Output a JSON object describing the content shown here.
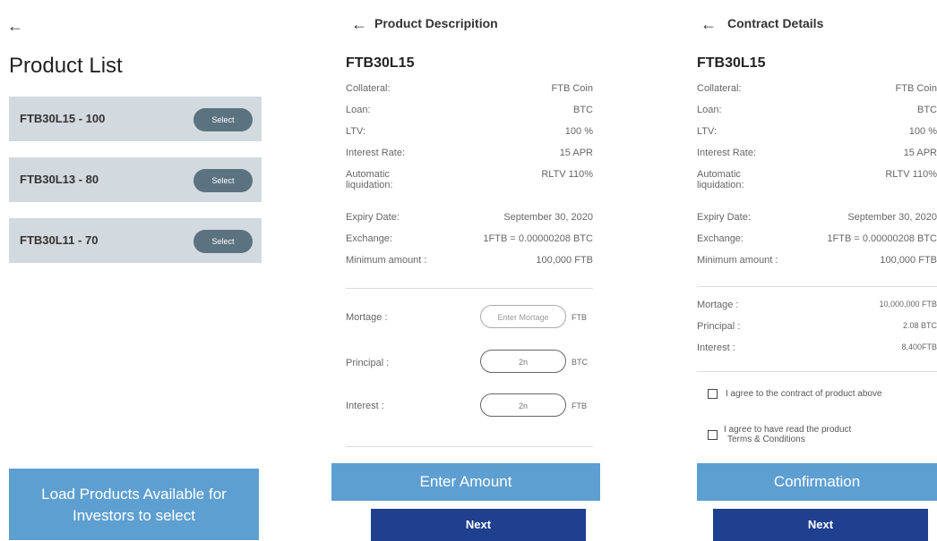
{
  "screen1": {
    "back_icon": "←",
    "title": "Product List",
    "products": [
      {
        "label": "FTB30L15 - 100",
        "button": "Select"
      },
      {
        "label": "FTB30L13 - 80",
        "button": "Select"
      },
      {
        "label": "FTB30L11 - 70",
        "button": "Select"
      }
    ],
    "load_box": "Load Products Available for Investors to select"
  },
  "screen2": {
    "back_icon": "←",
    "header": "Product Descripition",
    "code": "FTB30L15",
    "details": [
      {
        "label": "Collateral:",
        "value": "FTB Coin"
      },
      {
        "label": "Loan:",
        "value": "BTC"
      },
      {
        "label": "LTV:",
        "value": "100 %"
      },
      {
        "label": "Interest Rate:",
        "value": "15  APR"
      },
      {
        "label": "Automatic liquidation:",
        "value": "RLTV 110%"
      },
      {
        "label": "Expiry Date:",
        "value": "September 30, 2020"
      },
      {
        "label": "Exchange:",
        "value": "1FTB = 0.00000208 BTC"
      },
      {
        "label": "Minimum amount :",
        "value": "100,000 FTB"
      }
    ],
    "inputs": [
      {
        "label": "Mortage :",
        "value": "Enter Mortage",
        "unit": "FTB"
      },
      {
        "label": "Principal :",
        "value": "2n",
        "unit": "BTC"
      },
      {
        "label": "Interest :",
        "value": "2n",
        "unit": "FTB"
      }
    ],
    "enter_box": "Enter Amount",
    "next": "Next"
  },
  "screen3": {
    "back_icon": "←",
    "header": "Contract Details",
    "code": "FTB30L15",
    "details": [
      {
        "label": "Collateral:",
        "value": "FTB Coin"
      },
      {
        "label": "Loan:",
        "value": "BTC"
      },
      {
        "label": "LTV:",
        "value": "100 %"
      },
      {
        "label": "Interest Rate:",
        "value": "15  APR"
      },
      {
        "label": "Automatic liquidation:",
        "value": "RLTV 110%"
      },
      {
        "label": "Expiry Date:",
        "value": "September 30, 2020"
      },
      {
        "label": "Exchange:",
        "value": "1FTB = 0.00000208 BTC"
      },
      {
        "label": "Minimum amount :",
        "value": "100,000 FTB"
      }
    ],
    "summary": [
      {
        "label": "Mortage :",
        "value": "10,000,000 FTB"
      },
      {
        "label": "Principal :",
        "value": "2.08 BTC"
      },
      {
        "label": "Interest :",
        "value": "8,400FTB"
      }
    ],
    "agree1": "I agree to the contract of product above",
    "agree2_line1": "I agree to have read the product",
    "agree2_line2": "Terms & Conditions",
    "confirm_box": "Confirmation",
    "next": "Next"
  }
}
